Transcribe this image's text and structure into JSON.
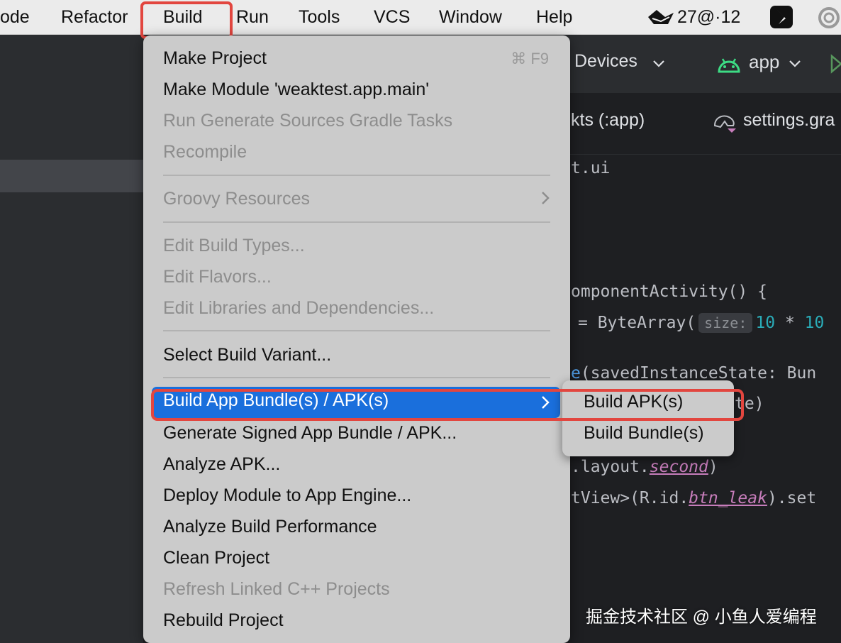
{
  "menubar": {
    "items": [
      "ode",
      "Refactor",
      "Build",
      "Run",
      "Tools",
      "VCS",
      "Window",
      "Help"
    ],
    "tray_text": "27@·12"
  },
  "ide": {
    "devices_label": "Devices",
    "run_config": "app",
    "tabs": [
      "kts (:app)",
      "settings.gra"
    ],
    "code_lines": {
      "l1": "t.ui",
      "l2a": "omponentActivity() {",
      "l3a": "= ByteArray(",
      "l3hint": "size:",
      "l3b": "10",
      "l3c": " * ",
      "l3d": "10",
      "l4a": "e",
      "l4b": "(savedInstanceState: Bun",
      "l5": "te)",
      "l6a": ".layout.",
      "l6b": "second",
      "l6c": ")",
      "l7a": "tView>(R.id.",
      "l7b": "btn_leak",
      "l7c": ").set"
    }
  },
  "build_menu": {
    "make_project": "Make Project",
    "make_project_shortcut": "⌘ F9",
    "make_module": "Make Module 'weaktest.app.main'",
    "run_generate": "Run Generate Sources Gradle Tasks",
    "recompile": "Recompile",
    "groovy_resources": "Groovy Resources",
    "edit_build_types": "Edit Build Types...",
    "edit_flavors": "Edit Flavors...",
    "edit_libraries": "Edit Libraries and Dependencies...",
    "select_build_variant": "Select Build Variant...",
    "build_app_bundle": "Build App Bundle(s) / APK(s)",
    "generate_signed": "Generate Signed App Bundle / APK...",
    "analyze_apk": "Analyze APK...",
    "deploy_module": "Deploy Module to App Engine...",
    "analyze_build_perf": "Analyze Build Performance",
    "clean_project": "Clean Project",
    "refresh_linked": "Refresh Linked C++ Projects",
    "rebuild_project": "Rebuild Project"
  },
  "submenu": {
    "build_apks": "Build APK(s)",
    "build_bundles": "Build Bundle(s)"
  },
  "watermark": "掘金技术社区 @ 小鱼人爱编程",
  "colors": {
    "highlight": "#1a6fdc",
    "annotation": "#e2463f",
    "menu_bg": "#cbcbcb",
    "ide_bg": "#1e1f22"
  }
}
